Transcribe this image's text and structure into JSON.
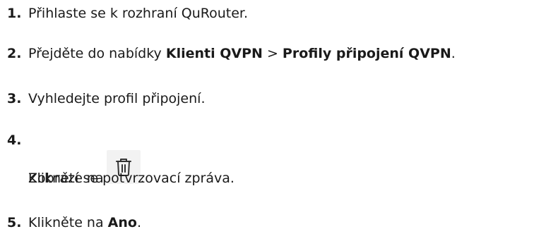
{
  "steps": [
    {
      "number": "1.",
      "text": "Přihlaste se k rozhraní QuRouter."
    },
    {
      "number": "2.",
      "text_before": "Přejděte do nabídky ",
      "bold_1": "Klienti QVPN",
      "separator": " > ",
      "bold_2": "Profily připojení QVPN",
      "text_after": "."
    },
    {
      "number": "3.",
      "text": "Vyhledejte profil připojení."
    },
    {
      "number": "4.",
      "text_before": "Klikněte na",
      "icon": "trash-icon",
      "text_after": ".",
      "note": "Zobrazí se potvrzovací zpráva."
    },
    {
      "number": "5.",
      "text_before": "Klikněte na ",
      "bold": "Ano",
      "text_after": "."
    }
  ],
  "colors": {
    "text": "#1a1a1a",
    "icon_background": "#f2f2f2",
    "icon_stroke": "#333333"
  }
}
